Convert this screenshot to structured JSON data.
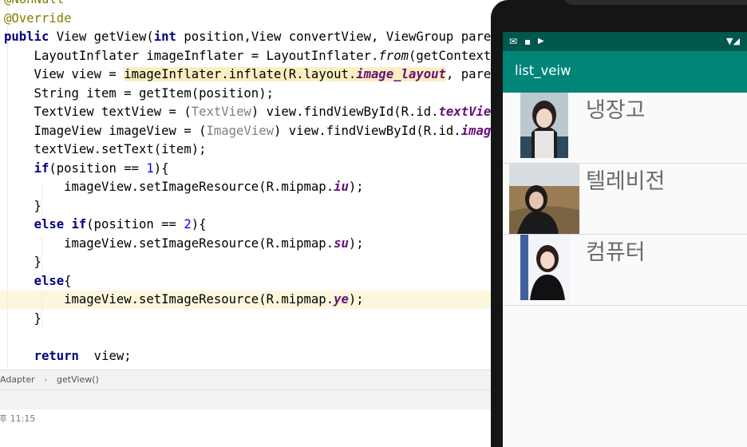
{
  "editor": {
    "lines": [
      {
        "t": [
          {
            "s": "@NonNull",
            "c": "ann"
          }
        ]
      },
      {
        "t": [
          {
            "s": "@Override",
            "c": "ann"
          }
        ]
      },
      {
        "t": [
          {
            "s": "public",
            "c": "kw"
          },
          {
            "s": " View getView("
          },
          {
            "s": "int",
            "c": "kw"
          },
          {
            "s": " position,View convertView, ViewGroup parent) {"
          }
        ]
      },
      {
        "t": [
          {
            "s": "    LayoutInflater imageInflater = LayoutInflater."
          },
          {
            "s": "from",
            "c": "it"
          },
          {
            "s": "(getContext());"
          }
        ]
      },
      {
        "t": [
          {
            "s": "    View view = "
          },
          {
            "s": "imageInflater.inflate(R.layout.",
            "c": "hi"
          },
          {
            "s": "image_layout",
            "c": "fld hi"
          },
          {
            "s": ", parent, false);"
          }
        ]
      },
      {
        "t": [
          {
            "s": "    String item = getItem(position);"
          }
        ]
      },
      {
        "t": [
          {
            "s": "    TextView textView = ("
          },
          {
            "s": "TextView",
            "c": "cast"
          },
          {
            "s": ") view.findViewById(R.id."
          },
          {
            "s": "textView",
            "c": "fld"
          },
          {
            "s": ");"
          }
        ]
      },
      {
        "t": [
          {
            "s": "    ImageView imageView = ("
          },
          {
            "s": "ImageView",
            "c": "cast"
          },
          {
            "s": ") view.findViewById(R.id."
          },
          {
            "s": "imageView",
            "c": "fld"
          },
          {
            "s": ");"
          }
        ]
      },
      {
        "t": [
          {
            "s": "    textView.setText(item);"
          }
        ]
      },
      {
        "t": [
          {
            "s": "    "
          },
          {
            "s": "if",
            "c": "kw"
          },
          {
            "s": "(position == "
          },
          {
            "s": "1",
            "c": "num"
          },
          {
            "s": "){"
          }
        ]
      },
      {
        "t": [
          {
            "s": "        imageView.setImageResource(R.mipmap."
          },
          {
            "s": "iu",
            "c": "fld"
          },
          {
            "s": ");"
          }
        ]
      },
      {
        "t": [
          {
            "s": "    }"
          }
        ]
      },
      {
        "t": [
          {
            "s": "    "
          },
          {
            "s": "else if",
            "c": "kw"
          },
          {
            "s": "(position == "
          },
          {
            "s": "2",
            "c": "num"
          },
          {
            "s": "){"
          }
        ]
      },
      {
        "t": [
          {
            "s": "        imageView.setImageResource(R.mipmap."
          },
          {
            "s": "su",
            "c": "fld"
          },
          {
            "s": ");"
          }
        ]
      },
      {
        "t": [
          {
            "s": "    }"
          }
        ]
      },
      {
        "t": [
          {
            "s": "    "
          },
          {
            "s": "else",
            "c": "kw"
          },
          {
            "s": "{"
          }
        ]
      },
      {
        "t": [
          {
            "s": "        imageView.setImageResource(R.mipmap."
          },
          {
            "s": "ye",
            "c": "fld"
          },
          {
            "s": ");"
          }
        ],
        "current": true
      },
      {
        "t": [
          {
            "s": "    }"
          }
        ]
      },
      {
        "t": [
          {
            "s": ""
          }
        ]
      },
      {
        "t": [
          {
            "s": "    "
          },
          {
            "s": "return",
            "c": "kw"
          },
          {
            "s": "  view;"
          }
        ]
      }
    ]
  },
  "breadcrumb": {
    "class_name": "Adapter",
    "separator": "›",
    "method": "getView()"
  },
  "log": {
    "timestamp": "후 11:15"
  },
  "device": {
    "status_icons": [
      "✉",
      "▪",
      "▶"
    ],
    "status_right": "▼◢",
    "app_title": "list_veiw",
    "items": [
      {
        "label": "냉장고",
        "image_name": "portrait-iu"
      },
      {
        "label": "텔레비전",
        "image_name": "portrait-su"
      },
      {
        "label": "컴퓨터",
        "image_name": "portrait-ye"
      }
    ]
  },
  "colors": {
    "status_bar": "#00574b",
    "app_bar": "#008577",
    "keyword": "#000080",
    "annotation": "#808000",
    "field": "#660e7a",
    "number": "#0000ff",
    "current_line": "#fcf6dc"
  }
}
